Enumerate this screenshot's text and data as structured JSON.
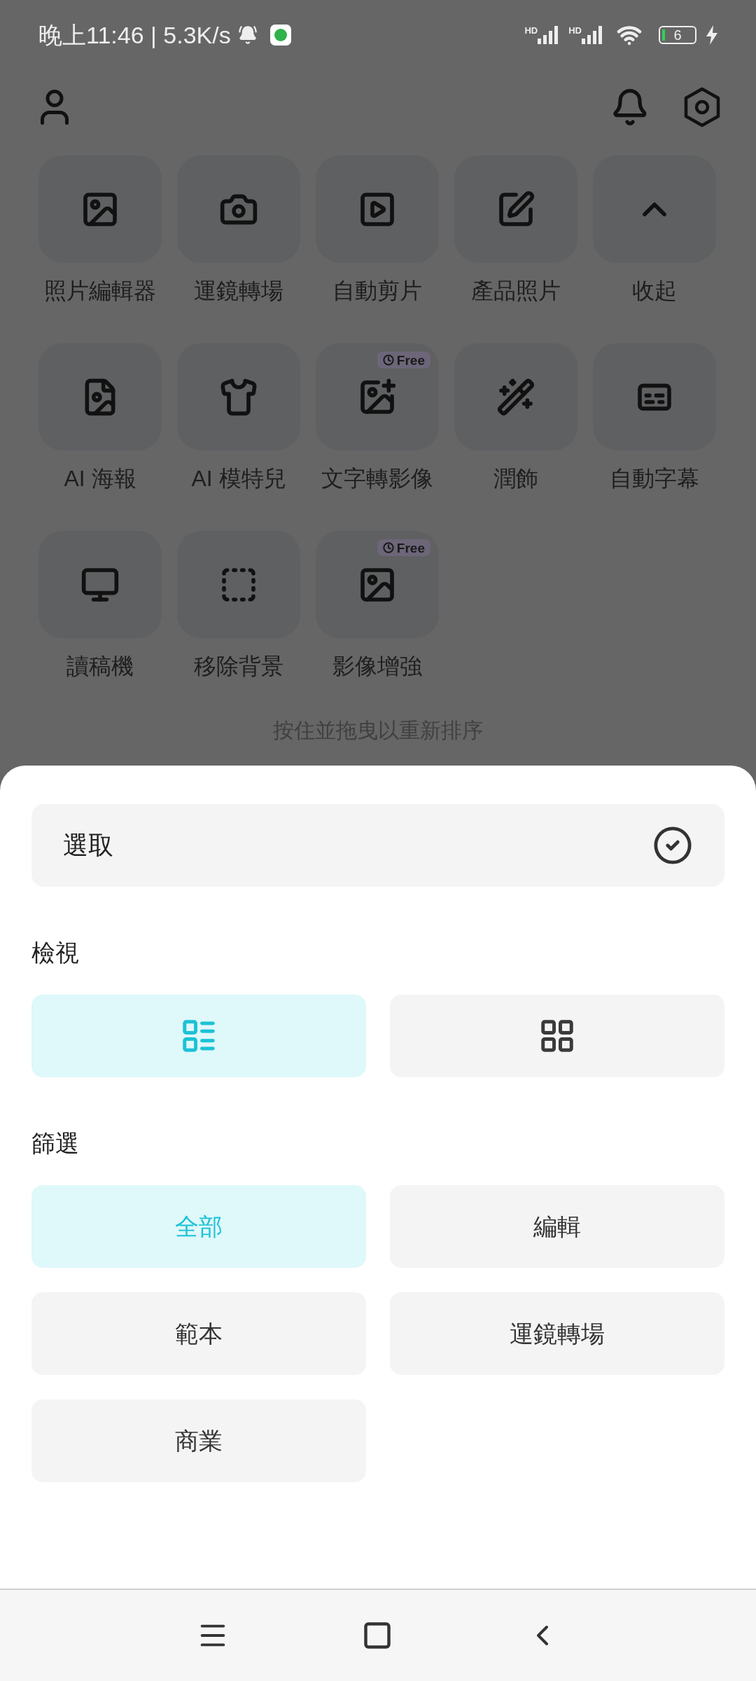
{
  "status_bar": {
    "time_speed": "晚上11:46 | 5.3K/s",
    "signals": [
      {
        "label": "HD"
      },
      {
        "label": "HD"
      }
    ],
    "battery": "6"
  },
  "tools": [
    {
      "kind": "photo",
      "label": "照片編輯器"
    },
    {
      "kind": "camera",
      "label": "運鏡轉場"
    },
    {
      "kind": "video",
      "label": "自動剪片"
    },
    {
      "kind": "product",
      "label": "產品照片"
    },
    {
      "kind": "collapse",
      "label": "收起"
    },
    {
      "kind": "poster",
      "label": "AI 海報"
    },
    {
      "kind": "shirt",
      "label": "AI 模特兒"
    },
    {
      "kind": "image_spark",
      "label": "文字轉影像",
      "badge": "Free"
    },
    {
      "kind": "retouch",
      "label": "潤飾"
    },
    {
      "kind": "captions",
      "label": "自動字幕"
    },
    {
      "kind": "monitor",
      "label": "讀稿機"
    },
    {
      "kind": "remove_bg",
      "label": "移除背景"
    },
    {
      "kind": "enhance",
      "label": "影像增強",
      "badge": "Free"
    }
  ],
  "hint": "按住並拖曳以重新排序",
  "sheet": {
    "select": "選取",
    "view_label": "檢視",
    "view_options": [
      {
        "kind": "list",
        "selected": true
      },
      {
        "kind": "grid",
        "selected": false
      }
    ],
    "filter_label": "篩選",
    "filters": [
      {
        "label": "全部",
        "selected": true
      },
      {
        "label": "編輯",
        "selected": false
      },
      {
        "label": "範本",
        "selected": false
      },
      {
        "label": "運鏡轉場",
        "selected": false
      },
      {
        "label": "商業",
        "selected": false
      }
    ]
  }
}
